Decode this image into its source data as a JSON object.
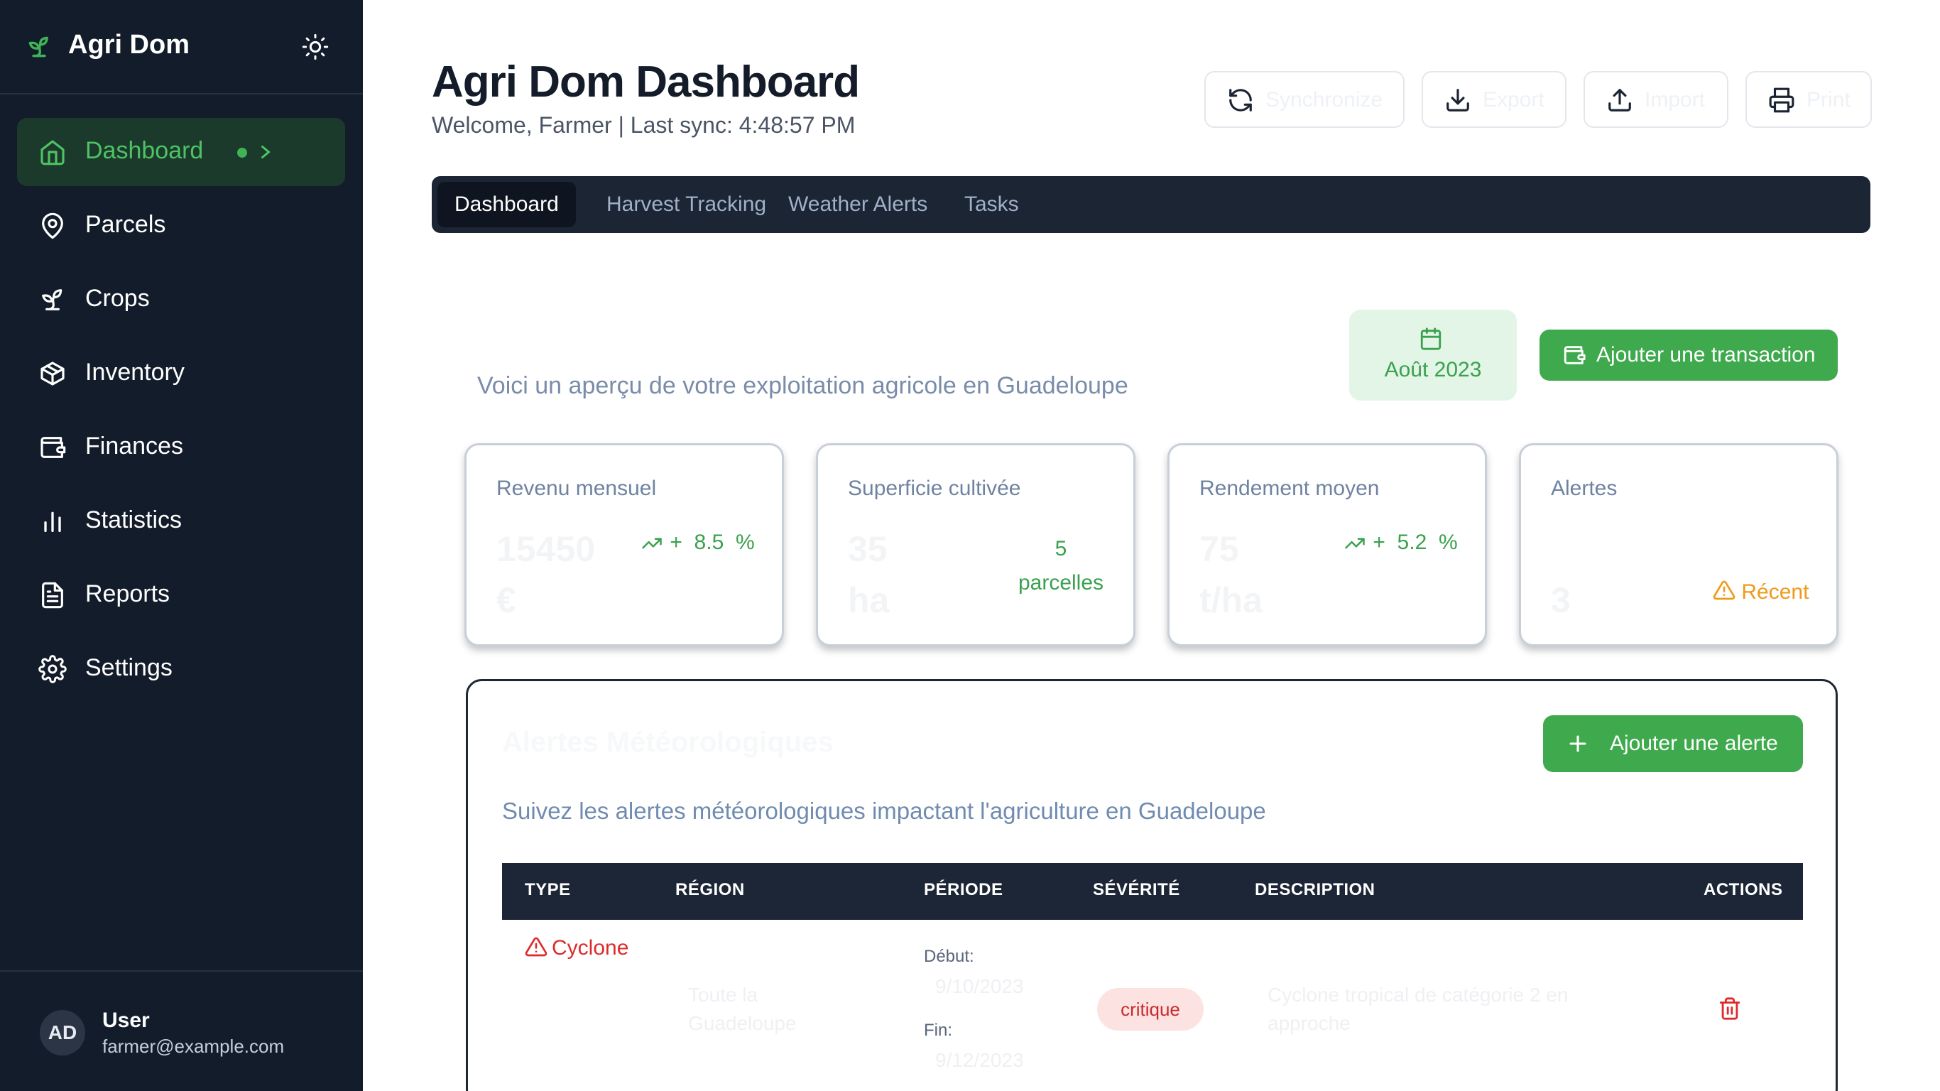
{
  "sidebar": {
    "brand": "Agri Dom",
    "items": [
      {
        "label": "Dashboard",
        "icon": "home-icon"
      },
      {
        "label": "Parcels",
        "icon": "map-pin-icon"
      },
      {
        "label": "Crops",
        "icon": "sprout-icon"
      },
      {
        "label": "Inventory",
        "icon": "package-icon"
      },
      {
        "label": "Finances",
        "icon": "wallet-icon"
      },
      {
        "label": "Statistics",
        "icon": "bar-chart-icon"
      },
      {
        "label": "Reports",
        "icon": "file-text-icon"
      },
      {
        "label": "Settings",
        "icon": "gear-icon"
      }
    ],
    "user": {
      "initials": "AD",
      "name": "User",
      "email": "farmer@example.com"
    }
  },
  "header": {
    "title": "Agri Dom Dashboard",
    "subtitle": "Welcome, Farmer | Last sync: 4:48:57 PM",
    "buttons": {
      "sync": "Synchronize",
      "export": "Export",
      "import": "Import",
      "print": "Print"
    }
  },
  "tabs": [
    "Dashboard",
    "Harvest Tracking",
    "Weather Alerts",
    "Tasks"
  ],
  "overview": {
    "subtitle": "Voici un aperçu de votre exploitation agricole en Guadeloupe",
    "date": "Août 2023",
    "add_transaction": "Ajouter une transaction"
  },
  "stats": [
    {
      "label": "Revenu mensuel",
      "value": "15450",
      "unit": "€",
      "trend_sign": "+",
      "trend_value": "8.5",
      "trend_unit": "%"
    },
    {
      "label": "Superficie cultivée",
      "value": "35",
      "unit": "ha",
      "side_value": "5",
      "side_label": "parcelles"
    },
    {
      "label": "Rendement moyen",
      "value": "75",
      "unit": "t/ha",
      "trend_sign": "+",
      "trend_value": "5.2",
      "trend_unit": "%"
    },
    {
      "label": "Alertes",
      "value": "3",
      "warn": "Récent"
    }
  ],
  "alerts": {
    "title": "Alertes Météorologiques",
    "subtitle": "Suivez les alertes météorologiques impactant l'agriculture en Guadeloupe",
    "add_button": "Ajouter une alerte",
    "columns": [
      "TYPE",
      "RÉGION",
      "PÉRIODE",
      "SÉVÉRITÉ",
      "DESCRIPTION",
      "ACTIONS"
    ],
    "rows": [
      {
        "type": "Cyclone",
        "region": "Toute la Guadeloupe",
        "start_label": "Début:",
        "start": "9/10/2023",
        "end_label": "Fin:",
        "end": "9/12/2023",
        "severity": "critique",
        "description": "Cyclone tropical de catégorie 2 en approche"
      }
    ]
  },
  "colors": {
    "sidebar": "#131c2b",
    "accent": "#3fa94d",
    "danger": "#dd2b2b",
    "warning": "#ef9a1a"
  }
}
